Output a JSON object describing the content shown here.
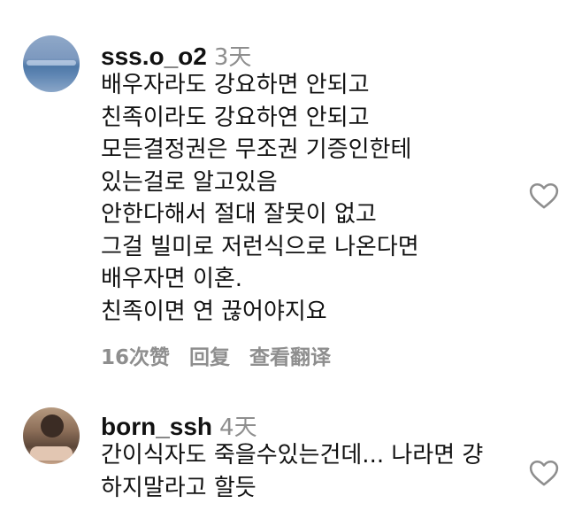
{
  "comments": [
    {
      "username": "sss.o_o2",
      "time": "3天",
      "lines": [
        "배우자라도 강요하면 안되고",
        "친족이라도 강요하연 안되고",
        "모든결정권은 무조권 기증인한테",
        "있는걸로 알고있음",
        "안한다해서 절대 잘못이 없고",
        "그걸 빌미로 저런식으로 나온다면",
        "배우자면 이혼.",
        "친족이면 연 끊어야지요"
      ],
      "likes": "16次赞",
      "reply": "回复",
      "translate": "查看翻译"
    },
    {
      "username": "born_ssh",
      "time": "4天",
      "lines": [
        "간이식자도 죽을수있는건데... 나라면 걍",
        "하지말라고 할듯"
      ]
    }
  ],
  "icons": {
    "like": "heart-icon"
  },
  "colors": {
    "text": "#111111",
    "muted": "#8e8e8e",
    "background": "#ffffff"
  }
}
